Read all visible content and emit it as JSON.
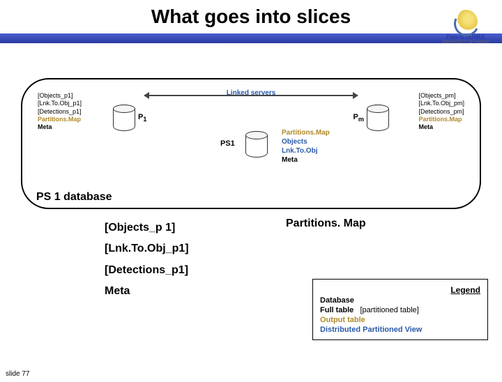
{
  "title": "What goes into slices",
  "logo": {
    "name": "Pan-STARRS",
    "sub": "UNIVERSITY OF HAWAII"
  },
  "bar": {},
  "diagram": {
    "linked": "Linked servers",
    "left": {
      "objects": "[Objects_p1]",
      "lnk": "[Lnk.To.Obj_p1]",
      "det": "[Detections_p1]",
      "pmap": "Partitions.Map",
      "meta": "Meta"
    },
    "right": {
      "objects": "[Objects_pm]",
      "lnk": "[Lnk.To.Obj_pm]",
      "det": "[Detections_pm]",
      "pmap": "Partitions.Map",
      "meta": "Meta"
    },
    "p1": "P1",
    "pm": "Pm",
    "ps1": "PS1",
    "ps1list": {
      "pmap": "Partitions.Map",
      "objects": "Objects",
      "lnk": "Lnk.To.Obj",
      "meta": "Meta"
    },
    "dblabel": "PS 1 database"
  },
  "lower": {
    "objects": "[Objects_p 1]",
    "lnk": "[Lnk.To.Obj_p1]",
    "det": "[Detections_p1]",
    "meta": "Meta",
    "pmap": "Partitions. Map"
  },
  "legend": {
    "title": "Legend",
    "db": "Database",
    "full": "Full table",
    "part": "[partitioned table]",
    "out": "Output table",
    "dpv": "Distributed Partitioned View"
  },
  "slide": "slide 77"
}
